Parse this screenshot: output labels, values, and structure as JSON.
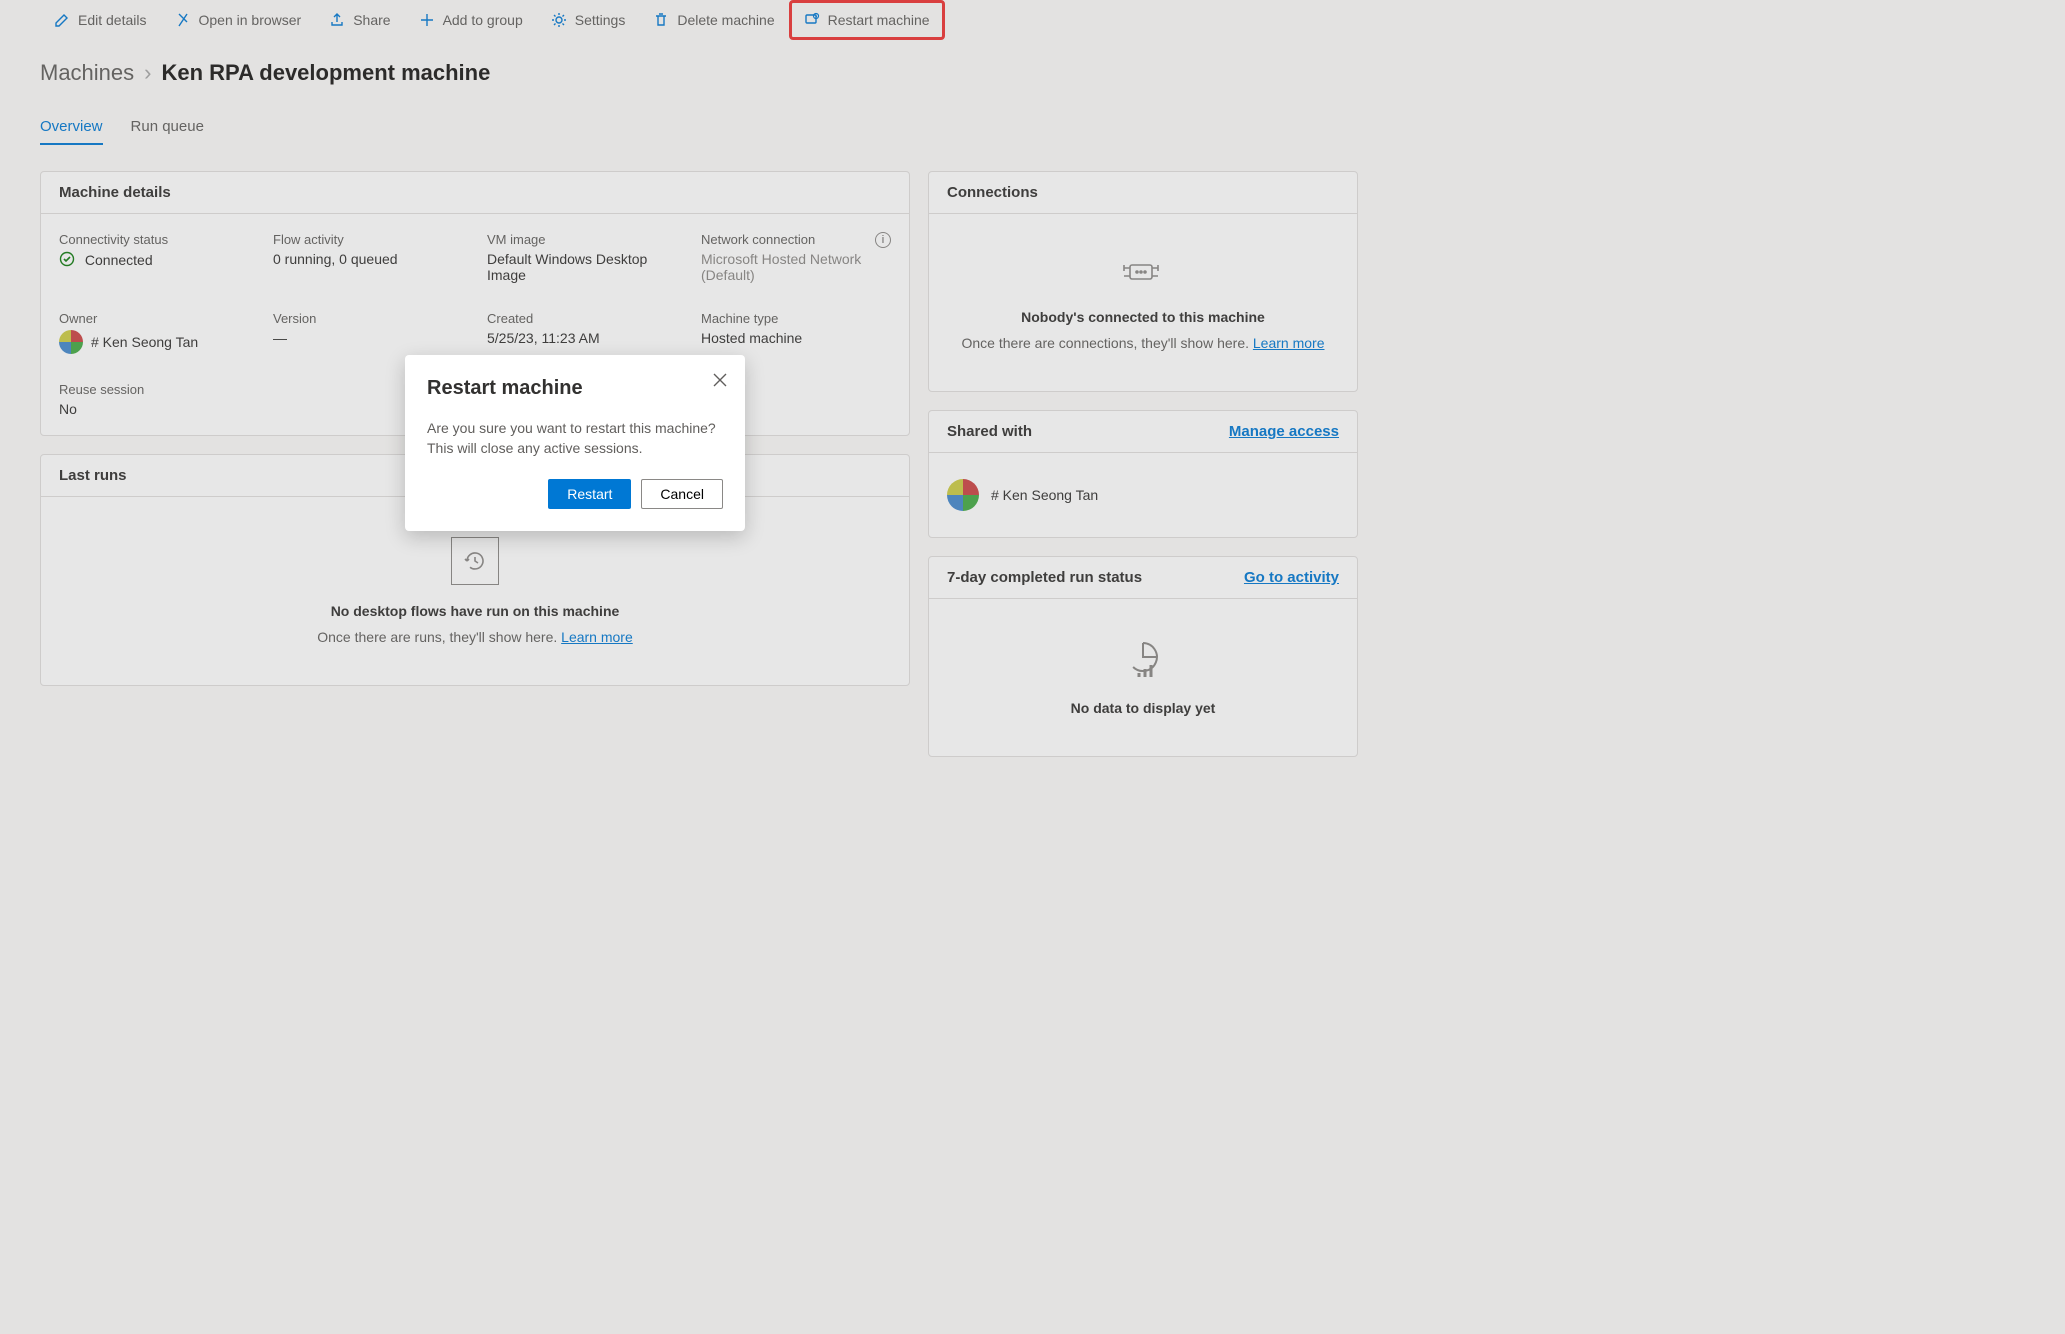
{
  "commands": {
    "edit": "Edit details",
    "open": "Open in browser",
    "share": "Share",
    "add": "Add to group",
    "settings": "Settings",
    "delete": "Delete machine",
    "restart": "Restart machine"
  },
  "breadcrumb": {
    "root": "Machines",
    "current": "Ken RPA development machine"
  },
  "tabs": {
    "overview": "Overview",
    "run_queue": "Run queue"
  },
  "details": {
    "card_title": "Machine details",
    "connectivity_label": "Connectivity status",
    "connectivity_value": "Connected",
    "flow_label": "Flow activity",
    "flow_value": "0 running, 0 queued",
    "vm_label": "VM image",
    "vm_value": "Default Windows Desktop Image",
    "net_label": "Network connection",
    "net_value": "Microsoft Hosted Network (Default)",
    "owner_label": "Owner",
    "owner_value": "# Ken Seong Tan",
    "version_label": "Version",
    "version_value": "—",
    "created_label": "Created",
    "created_value": "5/25/23, 11:23 AM",
    "type_label": "Machine type",
    "type_value": "Hosted machine",
    "reuse_label": "Reuse session",
    "reuse_value": "No"
  },
  "last_runs": {
    "card_title": "Last runs",
    "empty_title": "No desktop flows have run on this machine",
    "empty_sub_before": "Once there are runs, they'll show here. ",
    "learn_more": "Learn more"
  },
  "connections": {
    "card_title": "Connections",
    "empty_title": "Nobody's connected to this machine",
    "empty_sub_before": "Once there are connections, they'll show here. ",
    "learn_more": "Learn more"
  },
  "shared": {
    "card_title": "Shared with",
    "manage": "Manage access",
    "user": "# Ken Seong Tan"
  },
  "run_status": {
    "card_title": "7-day completed run status",
    "link": "Go to activity",
    "empty": "No data to display yet"
  },
  "dialog": {
    "title": "Restart machine",
    "body": "Are you sure you want to restart this machine? This will close any active sessions.",
    "primary": "Restart",
    "secondary": "Cancel"
  }
}
